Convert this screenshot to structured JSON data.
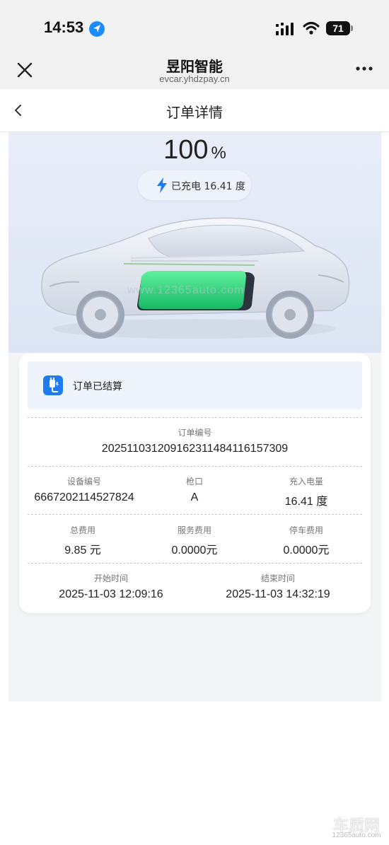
{
  "status_bar": {
    "time": "14:53",
    "battery": "71"
  },
  "browser": {
    "title": "昱阳智能",
    "url": "evcar.yhdzpay.cn"
  },
  "page": {
    "title": "订单详情"
  },
  "charging": {
    "percent": "100",
    "percent_sign": "%",
    "charged_text": "已充电 16.41 度"
  },
  "order": {
    "status_text": "订单已结算",
    "order_no_label": "订单编号",
    "order_no": "202511031209162311484116157309",
    "device_no_label": "设备编号",
    "device_no": "6667202114527824",
    "gun_label": "枪口",
    "gun": "A",
    "energy_label": "充入电量",
    "energy": "16.41 度",
    "total_fee_label": "总费用",
    "total_fee": "9.85 元",
    "service_fee_label": "服务费用",
    "service_fee": "0.0000元",
    "parking_fee_label": "停车费用",
    "parking_fee": "0.0000元",
    "start_time_label": "开始时间",
    "start_time": "2025-11-03 12:09:16",
    "end_time_label": "结束时间",
    "end_time": "2025-11-03 14:32:19"
  },
  "watermark": {
    "text": "www.12365auto.com"
  },
  "corner_logo": {
    "text": "车质网",
    "sub": "12365auto.com"
  },
  "colors": {
    "accent": "#1e7cf0",
    "battery_green": "#2fd47f",
    "hero_bg": "#e4eaf6"
  },
  "icons": [
    "location-arrow-icon",
    "signal-icon",
    "wifi-icon",
    "battery-icon",
    "close-icon",
    "more-icon",
    "back-chevron-icon",
    "lightning-icon",
    "charger-plug-icon",
    "car-illustration"
  ]
}
